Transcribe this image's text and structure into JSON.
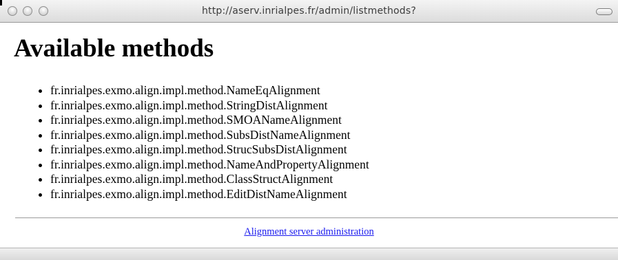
{
  "browser": {
    "url": "http://aserv.inrialpes.fr/admin/listmethods?"
  },
  "page": {
    "title": "Available methods",
    "methods": [
      "fr.inrialpes.exmo.align.impl.method.NameEqAlignment",
      "fr.inrialpes.exmo.align.impl.method.StringDistAlignment",
      "fr.inrialpes.exmo.align.impl.method.SMOANameAlignment",
      "fr.inrialpes.exmo.align.impl.method.SubsDistNameAlignment",
      "fr.inrialpes.exmo.align.impl.method.StrucSubsDistAlignment",
      "fr.inrialpes.exmo.align.impl.method.NameAndPropertyAlignment",
      "fr.inrialpes.exmo.align.impl.method.ClassStructAlignment",
      "fr.inrialpes.exmo.align.impl.method.EditDistNameAlignment"
    ],
    "footer_link": "Alignment server administration"
  },
  "colors": {
    "link": "#1a1aee",
    "separator": "#a8a8a8"
  }
}
